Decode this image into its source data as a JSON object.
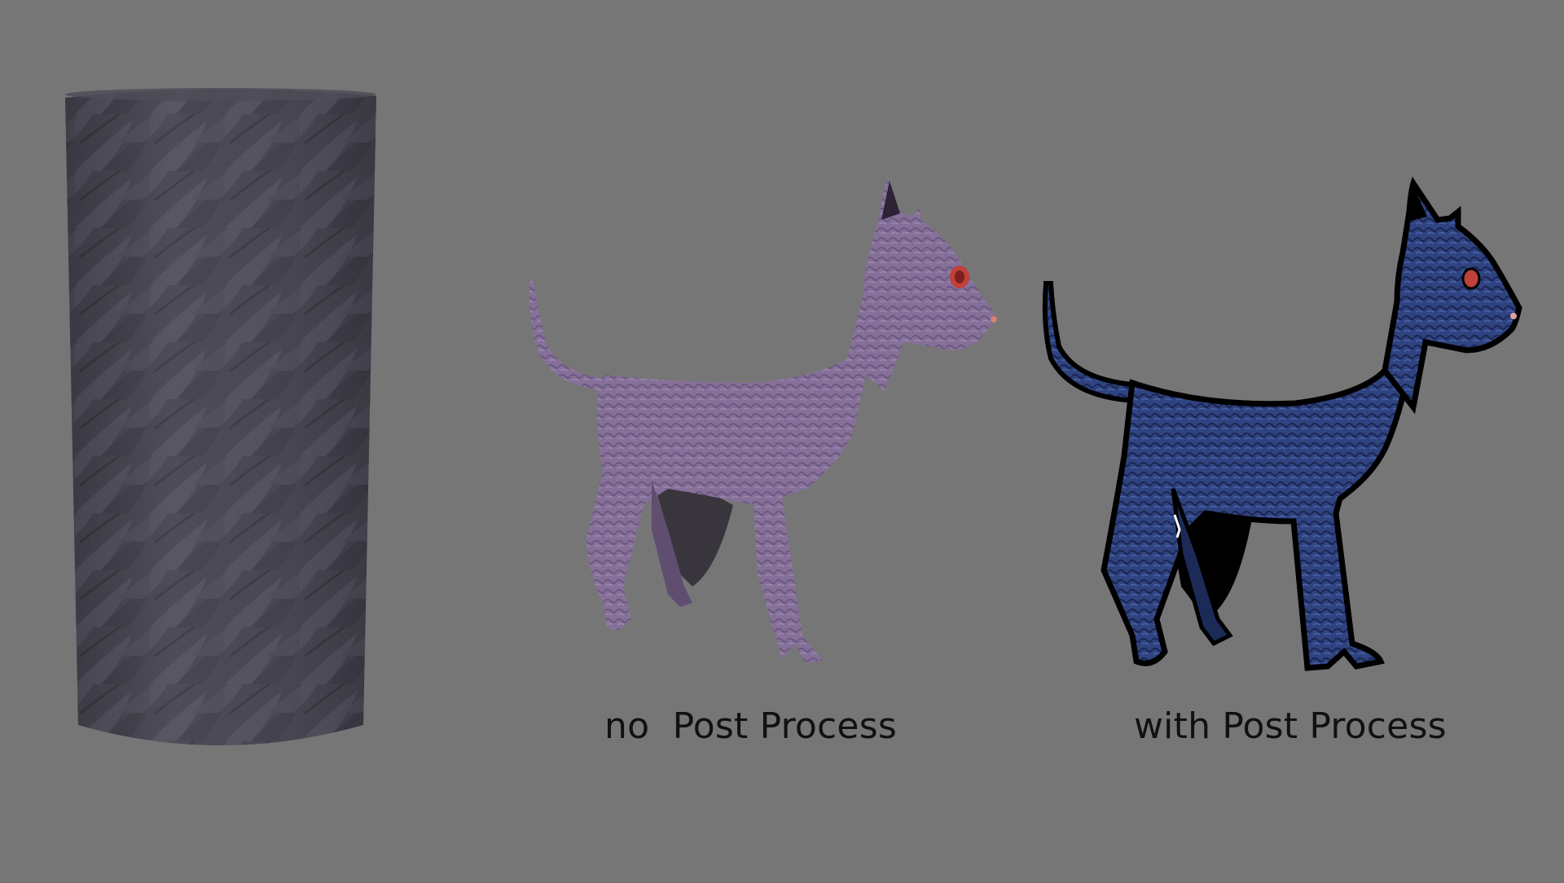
{
  "captions": {
    "no_post_process": "no  Post Process",
    "with_post_process": "with Post Process"
  },
  "colors": {
    "background": "#767676",
    "cylinder_base": "#4a4955",
    "cylinder_scale_light": "#5e5c6b",
    "cylinder_scale_dark": "#34333d",
    "cat_plain": "#86709a",
    "cat_plain_shade": "#5f4e70",
    "cat_processed": "#2c3f78",
    "cat_processed_outline": "#000000",
    "eye": "#c0403a",
    "caption_text": "#111111"
  },
  "objects": [
    {
      "name": "scale-textured-cylinder",
      "shape": "cylinder",
      "texture": "leaf-scales"
    },
    {
      "name": "cat-without-post-process",
      "style": "flat-lit"
    },
    {
      "name": "cat-with-post-process",
      "style": "outlined-high-contrast"
    }
  ]
}
